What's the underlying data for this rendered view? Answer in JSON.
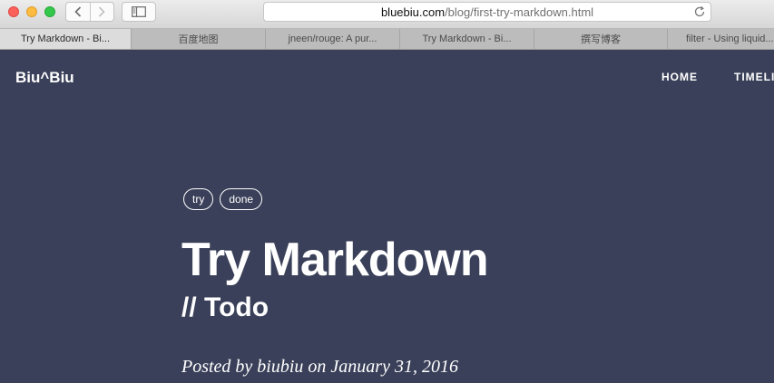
{
  "browser": {
    "url_domain": "bluebiu.com",
    "url_path": "/blog/first-try-markdown.html",
    "tabs": [
      {
        "label": "Try Markdown - Bi...",
        "active": true
      },
      {
        "label": "百度地图",
        "active": false
      },
      {
        "label": "jneen/rouge: A pur...",
        "active": false
      },
      {
        "label": "Try Markdown - Bi...",
        "active": false
      },
      {
        "label": "撰写博客",
        "active": false
      },
      {
        "label": "filter - Using liquid...",
        "active": false
      }
    ]
  },
  "site": {
    "brand": "Biu^Biu",
    "nav": {
      "home": "HOME",
      "timeline": "TIMELI"
    }
  },
  "post": {
    "tags": [
      "try",
      "done"
    ],
    "title": "Try Markdown",
    "subtitle": "// Todo",
    "meta": "Posted by biubiu on January 31, 2016"
  },
  "colors": {
    "page_background": "#3a4059",
    "text": "#ffffff"
  }
}
